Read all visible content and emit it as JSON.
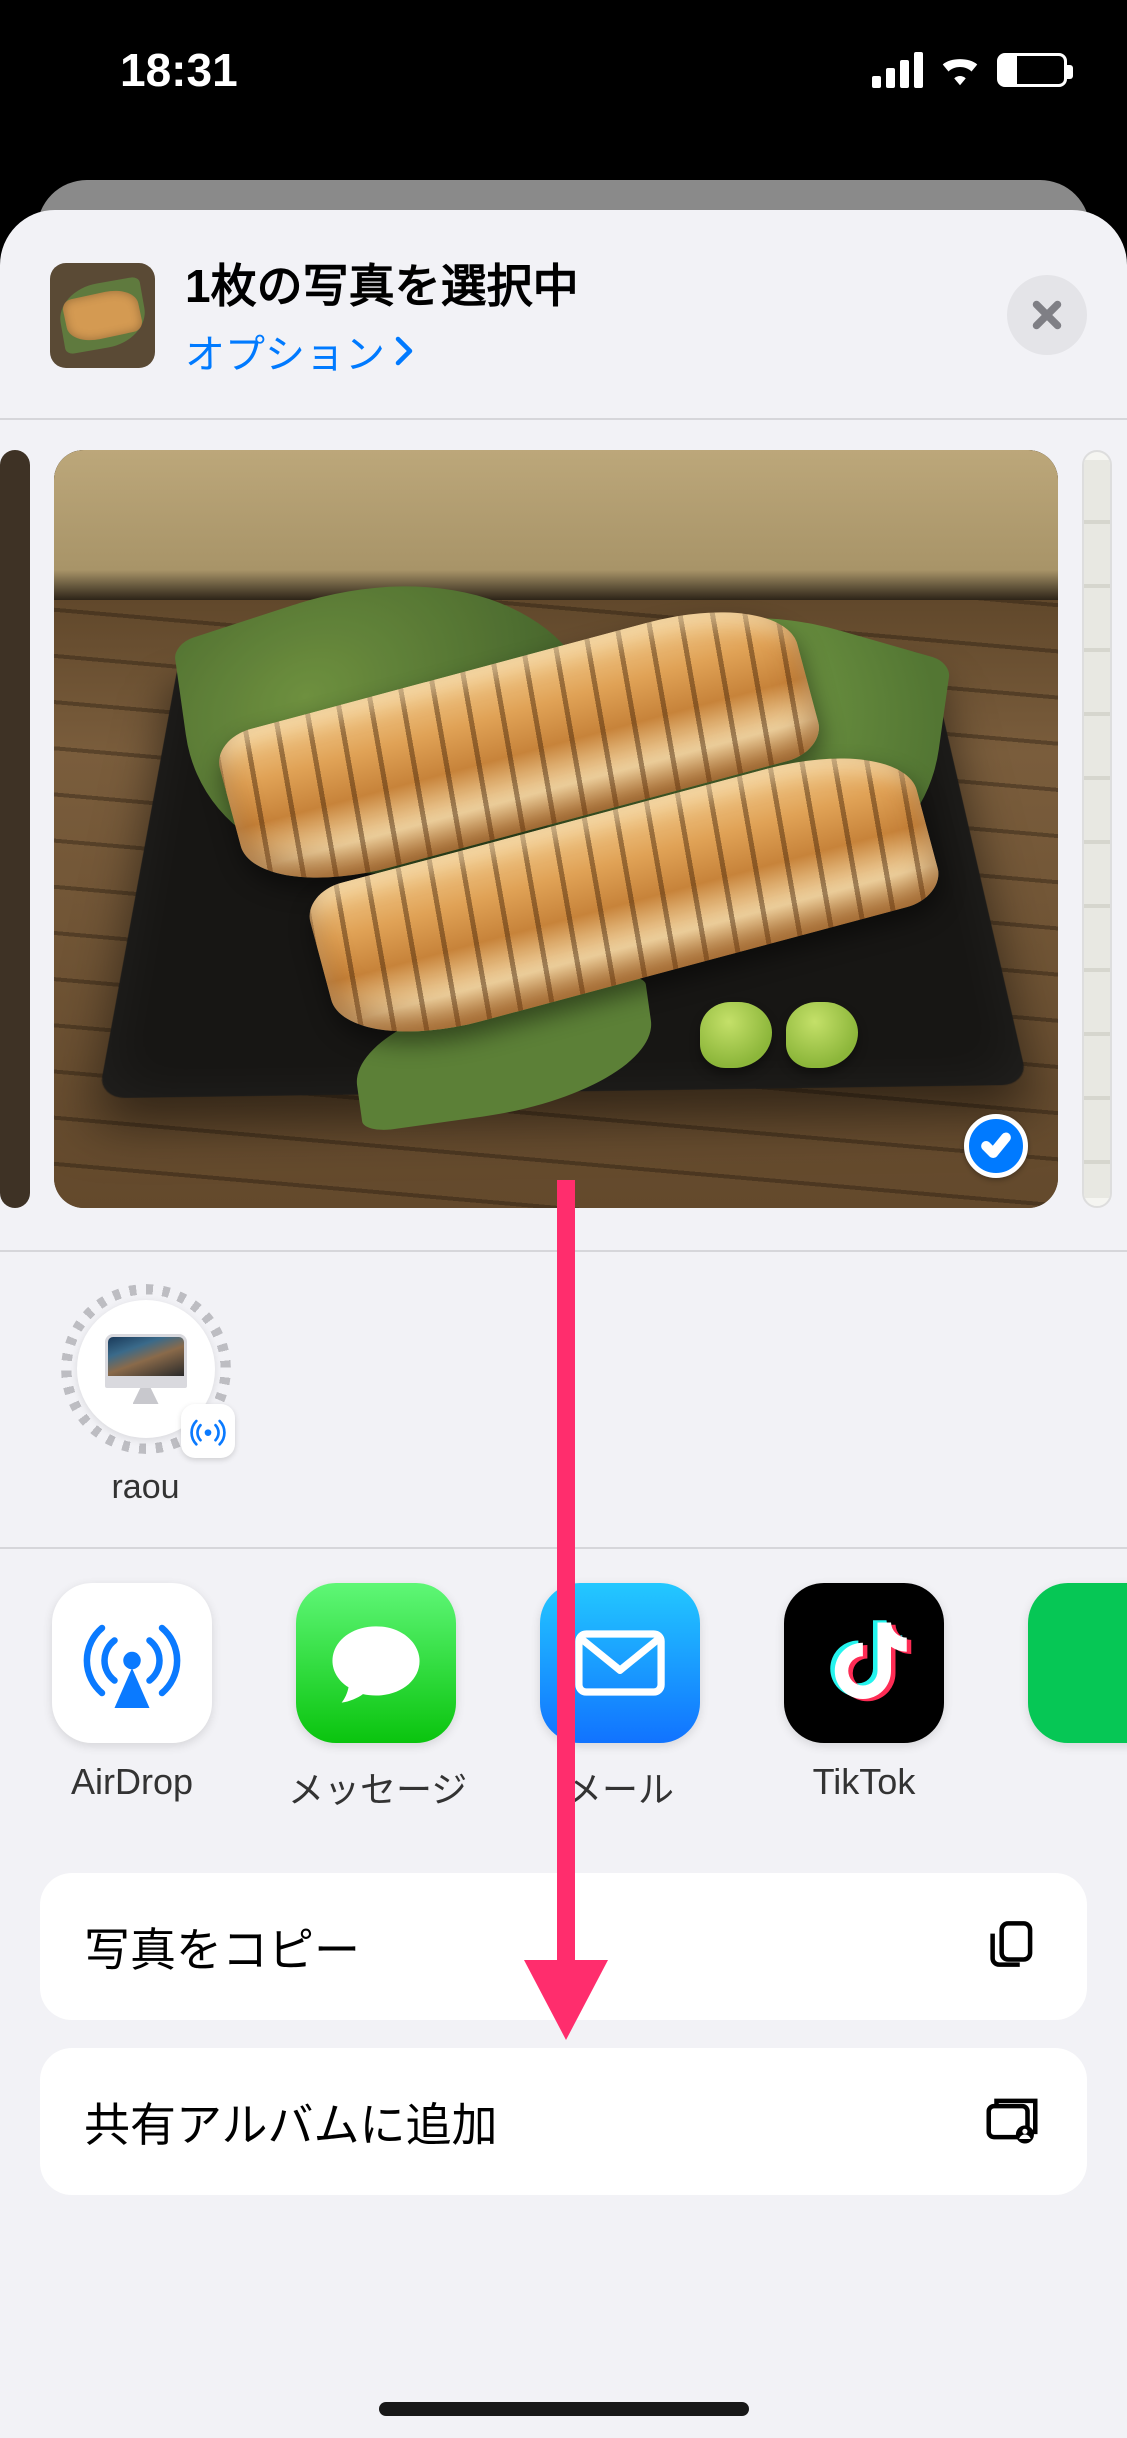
{
  "statusbar": {
    "time": "18:31"
  },
  "header": {
    "title": "1枚の写真を選択中",
    "options_label": "オプション"
  },
  "airdrop_contacts": [
    {
      "name": "raou"
    }
  ],
  "apps": [
    {
      "label": "AirDrop"
    },
    {
      "label": "メッセージ"
    },
    {
      "label": "メール"
    },
    {
      "label": "TikTok"
    }
  ],
  "actions": [
    {
      "label": "写真をコピー",
      "icon": "copy"
    },
    {
      "label": "共有アルバムに追加",
      "icon": "shared-album"
    }
  ]
}
